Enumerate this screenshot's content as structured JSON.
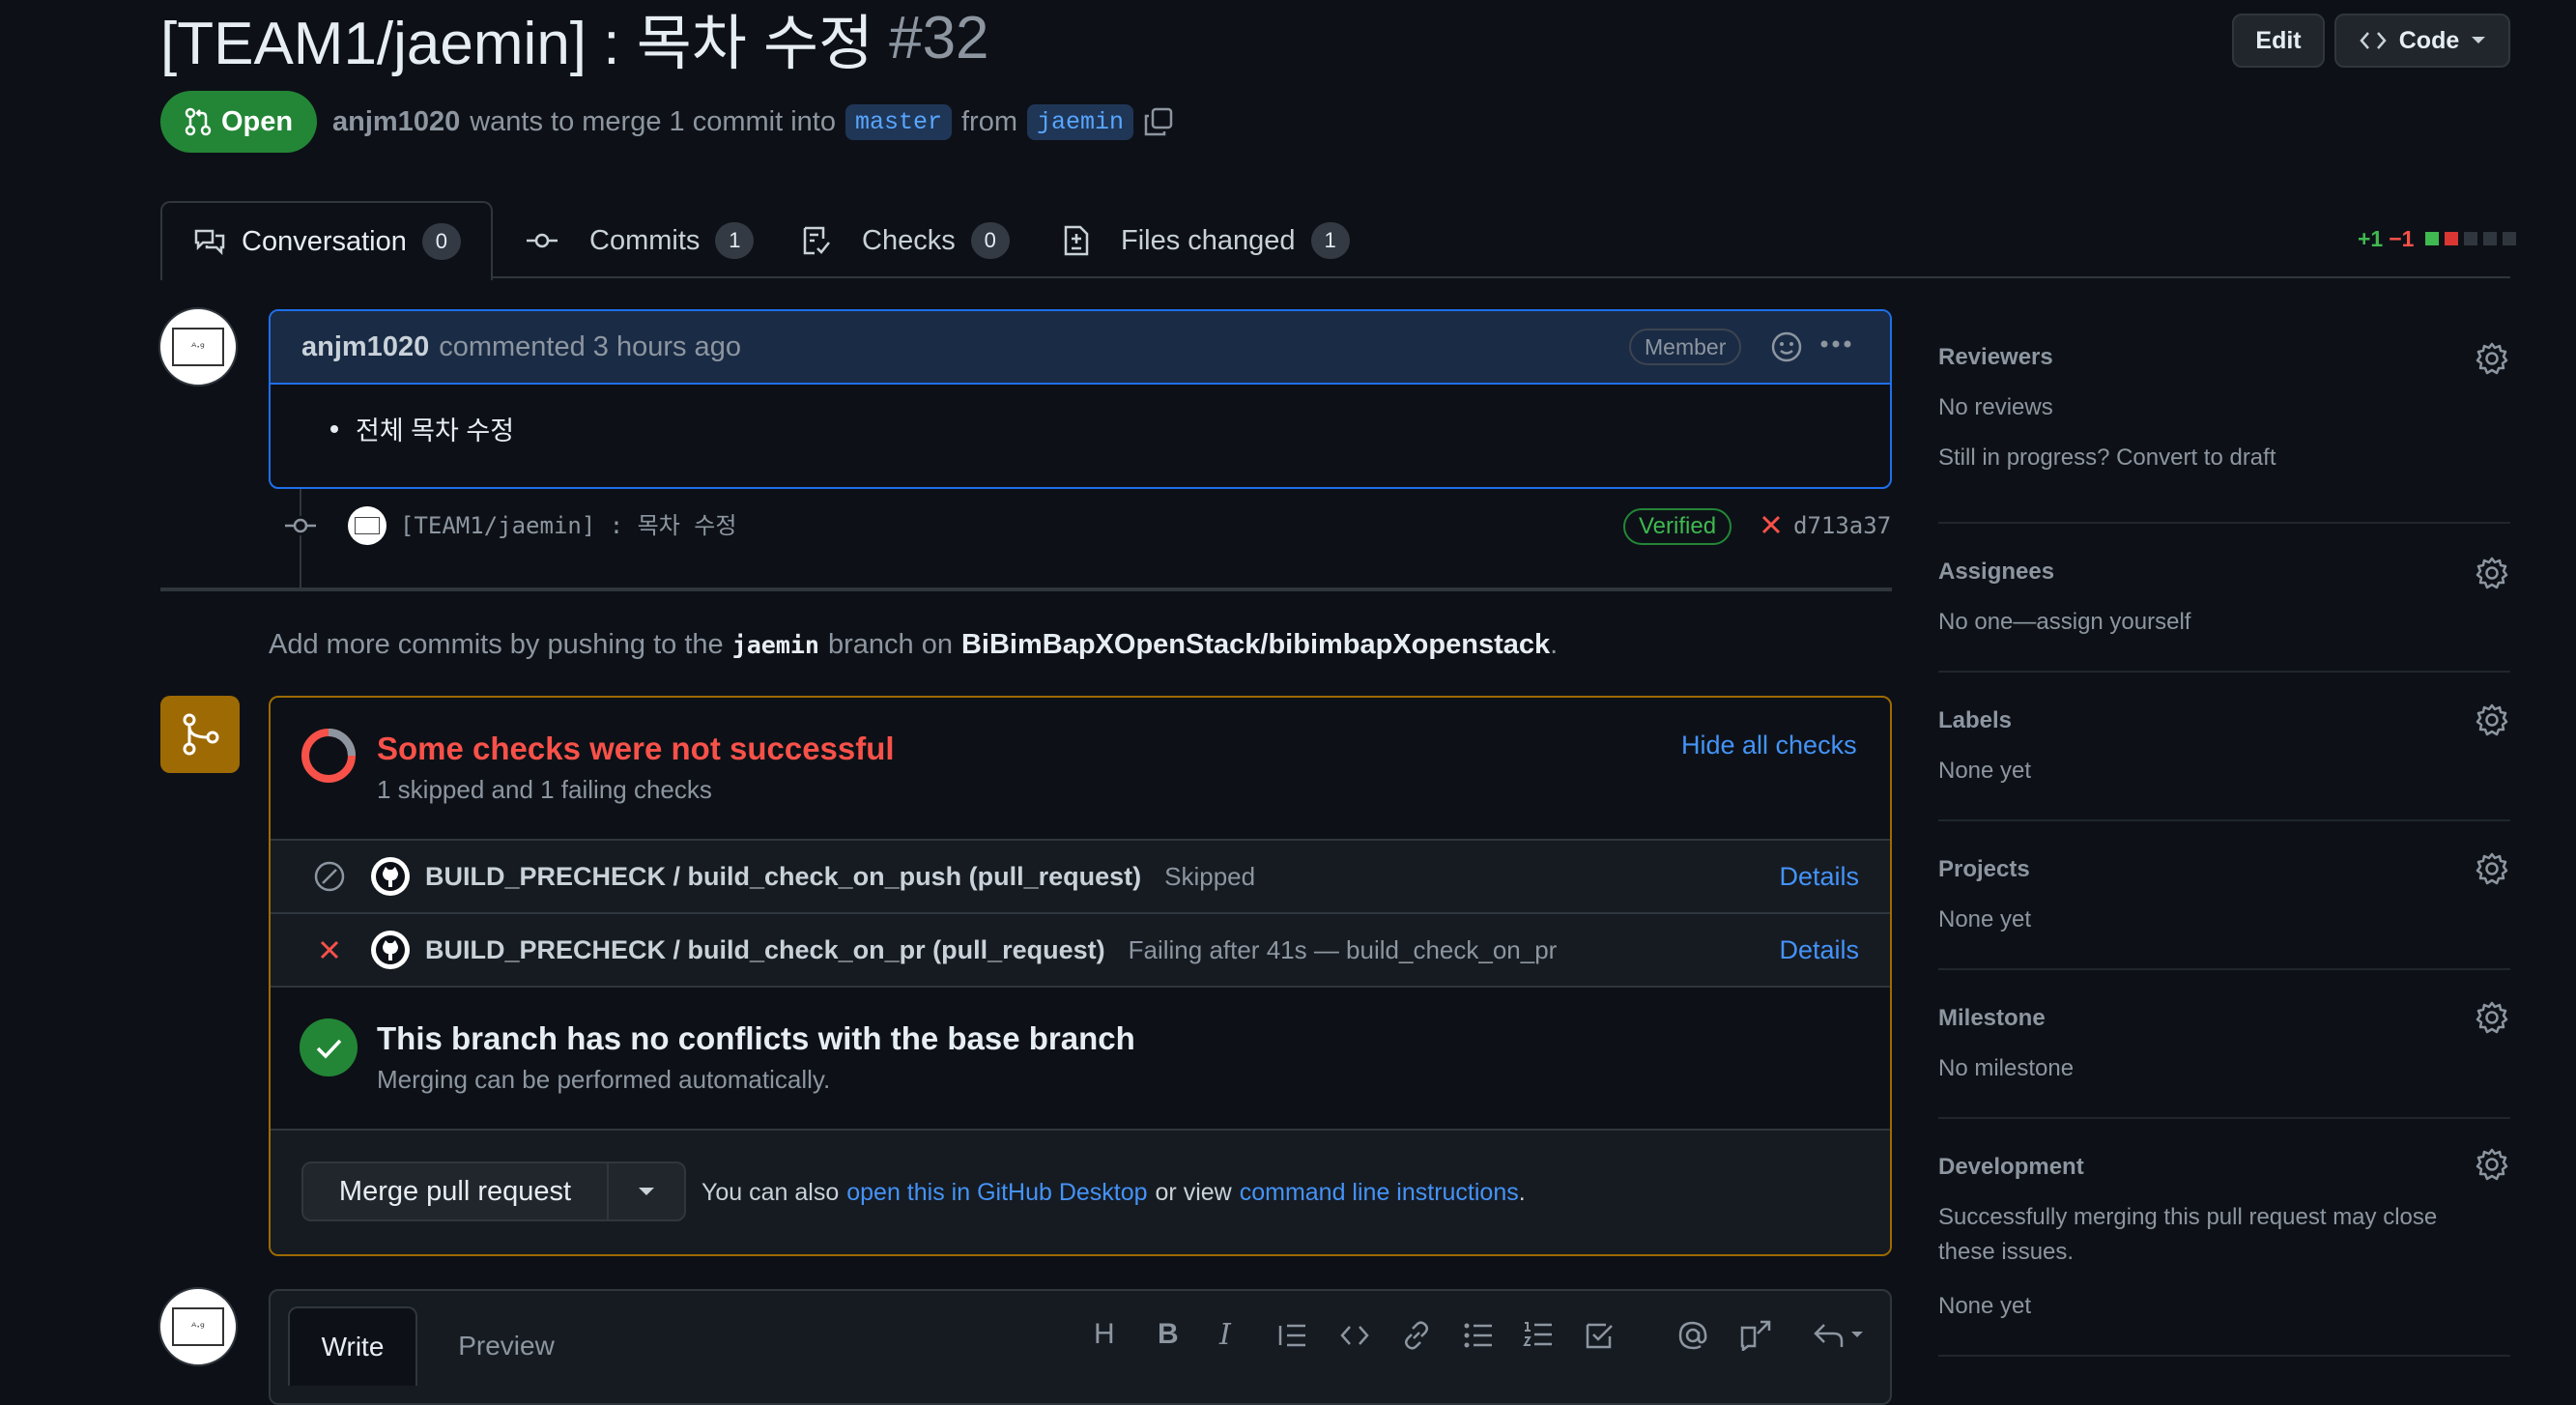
{
  "pr": {
    "title": "[TEAM1/jaemin] : 목차 수정",
    "number": "#32",
    "state": "Open",
    "author": "anjm1020",
    "merge_text": "wants to merge 1 commit into",
    "base_branch": "master",
    "from_text": "from",
    "head_branch": "jaemin"
  },
  "header_buttons": {
    "edit": "Edit",
    "code": "Code"
  },
  "tabs": [
    {
      "label": "Conversation",
      "count": "0"
    },
    {
      "label": "Commits",
      "count": "1"
    },
    {
      "label": "Checks",
      "count": "0"
    },
    {
      "label": "Files changed",
      "count": "1"
    }
  ],
  "diffstat": {
    "added": "+1",
    "removed": "−1"
  },
  "comment": {
    "author": "anjm1020",
    "meta": "commented 3 hours ago",
    "badge": "Member",
    "body_item": "전체 목차 수정"
  },
  "commit": {
    "message": "[TEAM1/jaemin] : 목차 수정",
    "verified": "Verified",
    "sha": "d713a37"
  },
  "push_hint": {
    "prefix": "Add more commits by pushing to the",
    "branch": "jaemin",
    "middle": "branch on",
    "repo": "BiBimBapXOpenStack/bibimbapXopenstack",
    "suffix": "."
  },
  "checks": {
    "title": "Some checks were not successful",
    "subtitle": "1 skipped and 1 failing checks",
    "hide_label": "Hide all checks",
    "rows": [
      {
        "name": "BUILD_PRECHECK / build_check_on_push (pull_request)",
        "status": "Skipped",
        "details": "Details"
      },
      {
        "name": "BUILD_PRECHECK / build_check_on_pr (pull_request)",
        "status": "Failing after 41s — build_check_on_pr",
        "details": "Details"
      }
    ],
    "conflict_title": "This branch has no conflicts with the base branch",
    "conflict_sub": "Merging can be performed automatically.",
    "merge_button": "Merge pull request",
    "also_prefix": "You can also",
    "desktop_link": "open this in GitHub Desktop",
    "or_view": "or view",
    "cli_link": "command line instructions",
    "period": "."
  },
  "editor": {
    "write": "Write",
    "preview": "Preview",
    "heading_glyph": "H",
    "bold_glyph": "B",
    "italic_glyph": "I"
  },
  "sidebar": {
    "reviewers": {
      "title": "Reviewers",
      "line1": "No reviews",
      "line2": "Still in progress? Convert to draft"
    },
    "assignees": {
      "title": "Assignees",
      "line1": "No one—assign yourself"
    },
    "labels": {
      "title": "Labels",
      "line1": "None yet"
    },
    "projects": {
      "title": "Projects",
      "line1": "None yet"
    },
    "milestone": {
      "title": "Milestone",
      "line1": "No milestone"
    },
    "development": {
      "title": "Development",
      "line1": "Successfully merging this pull request may close",
      "line2": "these issues.",
      "line3": "None yet"
    }
  },
  "colors": {
    "background": "#0d1117",
    "open_green": "#238636",
    "link_blue": "#4493f8",
    "fail_red": "#f85149",
    "warning_border": "#9e6a03"
  }
}
